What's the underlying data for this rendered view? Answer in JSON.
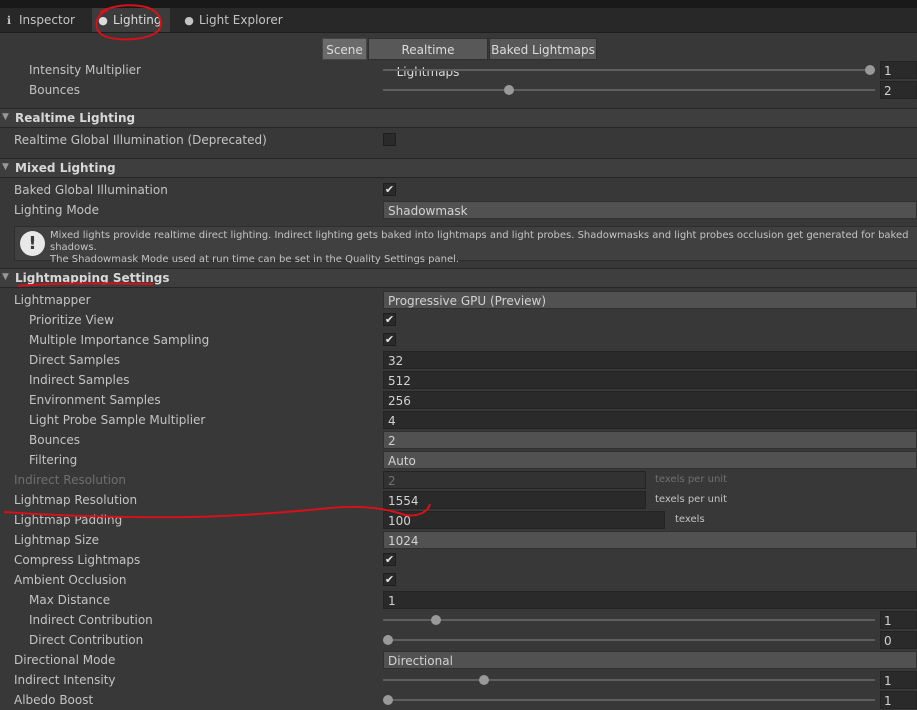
{
  "tabs": [
    {
      "label": "Inspector",
      "icon": "info-icon"
    },
    {
      "label": "Lighting",
      "icon": "bulb-icon"
    },
    {
      "label": "Light Explorer",
      "icon": "bulb-icon"
    }
  ],
  "mode_buttons": [
    "Scene",
    "Realtime Lightmaps",
    "Baked Lightmaps"
  ],
  "selected_mode": "Scene",
  "top": {
    "intensity_label": "Intensity Multiplier",
    "intensity_value": "1",
    "intensity_fraction": 1.0,
    "bounces_label": "Bounces",
    "bounces_value": "2",
    "bounces_fraction": 0.25
  },
  "realtime": {
    "header": "Realtime Lighting",
    "gi_label": "Realtime Global Illumination (Deprecated)",
    "gi_checked": false
  },
  "mixed": {
    "header": "Mixed Lighting",
    "baked_gi_label": "Baked Global Illumination",
    "baked_gi_checked": true,
    "mode_label": "Lighting Mode",
    "mode_value": "Shadowmask",
    "help_line1": "Mixed lights provide realtime direct lighting. Indirect lighting gets baked into lightmaps and light probes. Shadowmasks and light probes occlusion get generated for baked shadows.",
    "help_line2": "The Shadowmask Mode used at run time can be set in the Quality Settings panel."
  },
  "lightmapping": {
    "header": "Lightmapping Settings",
    "lightmapper_label": "Lightmapper",
    "lightmapper_value": "Progressive GPU (Preview)",
    "prioritize_label": "Prioritize View",
    "prioritize_checked": true,
    "mis_label": "Multiple Importance Sampling",
    "mis_checked": true,
    "direct_label": "Direct Samples",
    "direct_value": "32",
    "indirect_label": "Indirect Samples",
    "indirect_value": "512",
    "env_label": "Environment Samples",
    "env_value": "256",
    "probe_label": "Light Probe Sample Multiplier",
    "probe_value": "4",
    "bounces_label": "Bounces",
    "bounces_value": "2",
    "filtering_label": "Filtering",
    "filtering_value": "Auto",
    "ind_res_label": "Indirect Resolution",
    "ind_res_value": "2",
    "ind_res_suffix": "texels per unit",
    "lm_res_label": "Lightmap Resolution",
    "lm_res_value": "1554",
    "lm_res_suffix": "texels per unit",
    "padding_label": "Lightmap Padding",
    "padding_value": "100",
    "padding_suffix": "texels",
    "size_label": "Lightmap Size",
    "size_value": "1024",
    "compress_label": "Compress Lightmaps",
    "compress_checked": true,
    "ao_label": "Ambient Occlusion",
    "ao_checked": true,
    "maxdist_label": "Max Distance",
    "maxdist_value": "1",
    "indcontrib_label": "Indirect Contribution",
    "indcontrib_value": "1",
    "indcontrib_fraction": 0.1,
    "dircontrib_label": "Direct Contribution",
    "dircontrib_value": "0",
    "dircontrib_fraction": 0.0,
    "dirmode_label": "Directional Mode",
    "dirmode_value": "Directional",
    "indint_label": "Indirect Intensity",
    "indint_value": "1",
    "indint_fraction": 0.2,
    "albedo_label": "Albedo Boost",
    "albedo_value": "1",
    "albedo_fraction": 0.0
  },
  "colors": {
    "annotation": "#d8101a",
    "background": "#383838"
  }
}
